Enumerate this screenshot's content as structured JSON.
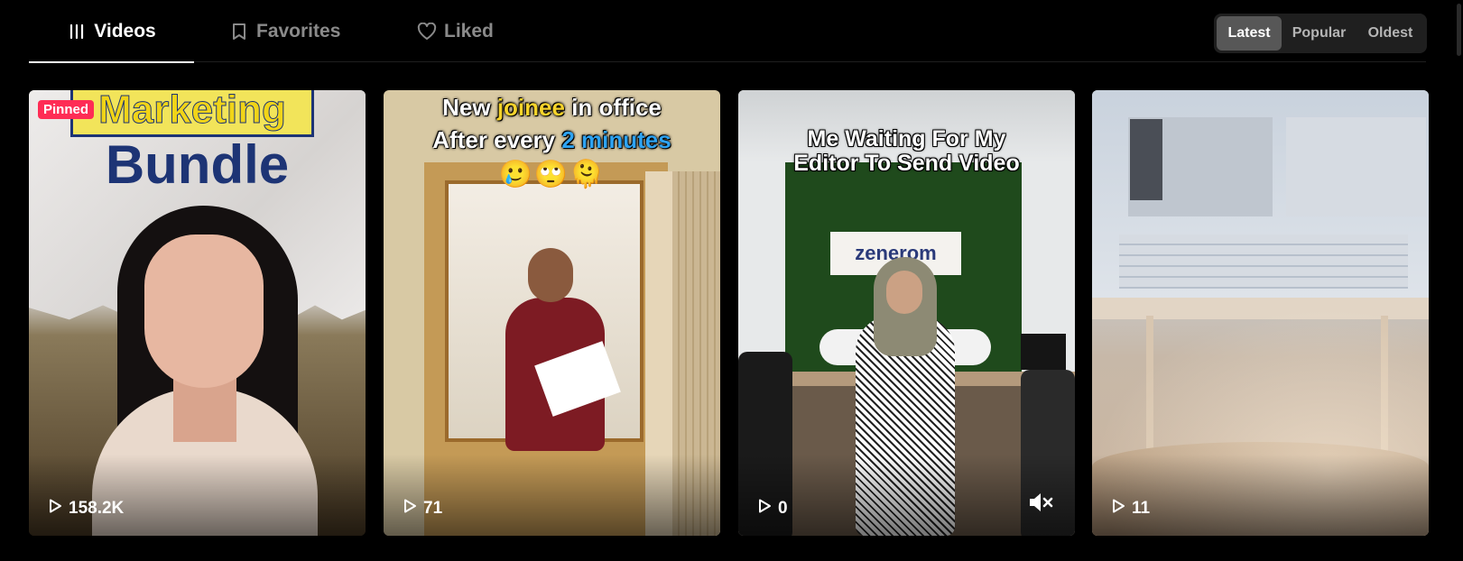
{
  "tabs": [
    {
      "label": "Videos",
      "icon": "grid-lines-icon",
      "active": true
    },
    {
      "label": "Favorites",
      "icon": "bookmark-icon",
      "active": false
    },
    {
      "label": "Liked",
      "icon": "heart-icon",
      "active": false
    }
  ],
  "sort": {
    "options": [
      "Latest",
      "Popular",
      "Oldest"
    ],
    "selected": "Latest"
  },
  "videos": [
    {
      "views": "158.2K",
      "pinned_label": "Pinned",
      "overlay_text": [
        "Marketing",
        "Bundle"
      ]
    },
    {
      "views": "71",
      "overlay_text": [
        "New joinee in office",
        "After every 2 minutes"
      ],
      "overlay_words": {
        "line1": [
          "New",
          "joinee",
          "in office"
        ],
        "line2": [
          "After every",
          "2 minutes"
        ]
      },
      "emoji": "🥲🙄🫠"
    },
    {
      "views": "0",
      "overlay_text": [
        "Me Waiting For My",
        "Editor To Send Video"
      ],
      "logo_text": "zenerom",
      "muted": true
    },
    {
      "views": "11"
    }
  ],
  "colors": {
    "background": "#000000",
    "tab_active": "#ffffff",
    "tab_inactive": "#8a8a8a",
    "pinned_badge": "#fe2c55",
    "sort_selected_bg": "#575757"
  }
}
